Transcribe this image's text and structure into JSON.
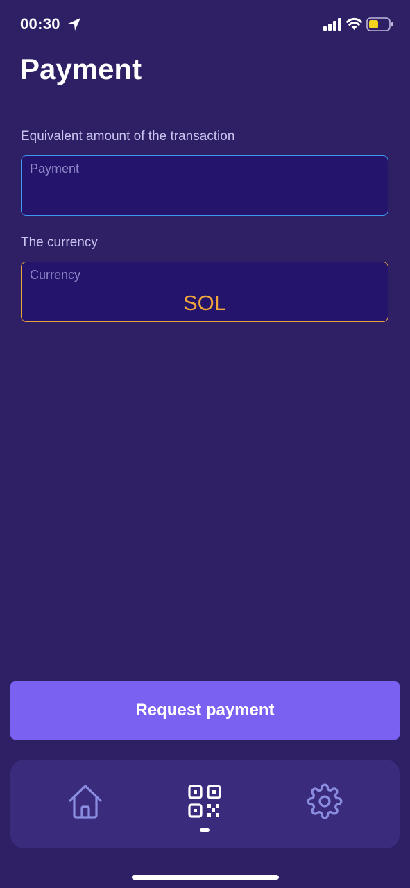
{
  "status_bar": {
    "time": "00:30",
    "icons": [
      "location-arrow-icon",
      "cellular-signal-icon",
      "wifi-icon",
      "battery-icon"
    ],
    "battery_color": "#f2d21f"
  },
  "page": {
    "title": "Payment"
  },
  "amount_field": {
    "label": "Equivalent amount of the transaction",
    "caption": "Payment",
    "value": "",
    "border_color": "#3c9bf0"
  },
  "currency_field": {
    "label": "The currency",
    "caption": "Currency",
    "value": "SOL",
    "accent_color": "#f0a63a"
  },
  "request_button": {
    "label": "Request payment",
    "color": "#7b61f1"
  },
  "tab_bar": {
    "tabs": [
      {
        "icon": "home-icon",
        "active": false
      },
      {
        "icon": "qr-code-icon",
        "active": true
      },
      {
        "icon": "gear-icon",
        "active": false
      }
    ]
  },
  "colors": {
    "background": "#2f2066",
    "field_background": "#24146b",
    "tab_bar_background": "#3b2b7d"
  }
}
